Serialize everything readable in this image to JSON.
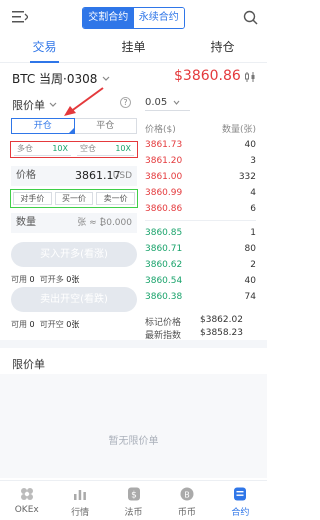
{
  "header": {
    "segment_active": "交割合约",
    "segment_inactive": "永续合约"
  },
  "tabs": [
    "交易",
    "挂单",
    "持仓"
  ],
  "instrument": {
    "name": "BTC 当周·0308",
    "last_price": "$3860.86"
  },
  "order_form": {
    "order_type": "限价单",
    "open_label": "开仓",
    "close_label": "平仓",
    "leverage_long_label": "多仓",
    "leverage_long_value": "10X",
    "leverage_short_label": "空仓",
    "leverage_short_value": "10X",
    "price_label": "价格",
    "price_value": "3861.17",
    "price_unit": "USD",
    "quick_buttons": [
      "对手价",
      "买一价",
      "卖一价"
    ],
    "quantity_label": "数量",
    "quantity_unit": "张 ≈ ₿0.000",
    "open_long_button": "买入开多(看涨)",
    "open_short_button": "卖出开空(看跌)",
    "avail_long": {
      "label1": "可用",
      "val1": "0",
      "label2": "可开多",
      "val2": "0张"
    },
    "avail_short": {
      "label1": "可用",
      "val1": "0",
      "label2": "可开空",
      "val2": "0张"
    }
  },
  "order_book": {
    "depth": "0.05",
    "col_price": "价格($)",
    "col_amount": "数量(张)",
    "asks": [
      {
        "price": "3861.73",
        "amount": "40"
      },
      {
        "price": "3861.20",
        "amount": "3"
      },
      {
        "price": "3861.00",
        "amount": "332"
      },
      {
        "price": "3860.99",
        "amount": "4"
      },
      {
        "price": "3860.86",
        "amount": "6"
      }
    ],
    "bids": [
      {
        "price": "3860.85",
        "amount": "1"
      },
      {
        "price": "3860.71",
        "amount": "80"
      },
      {
        "price": "3860.62",
        "amount": "2"
      },
      {
        "price": "3860.54",
        "amount": "40"
      },
      {
        "price": "3860.38",
        "amount": "74"
      }
    ],
    "mark_label": "标记价格",
    "mark_value": "$3862.02",
    "index_label": "最新指数",
    "index_value": "$3858.23"
  },
  "limit_orders": {
    "title": "限价单",
    "empty_text": "暂无限价单"
  },
  "bottom_nav": [
    {
      "label": "OKEx",
      "icon": "okex-logo-icon"
    },
    {
      "label": "行情",
      "icon": "market-chart-icon"
    },
    {
      "label": "法币",
      "icon": "fiat-icon"
    },
    {
      "label": "币币",
      "icon": "coin-icon"
    },
    {
      "label": "合约",
      "icon": "contract-icon"
    }
  ],
  "colors": {
    "accent": "#2f76e8",
    "ask_red": "#e4393c",
    "bid_green": "#19a36b",
    "annotation_red": "#e4393c",
    "annotation_green": "#3fcf48"
  }
}
